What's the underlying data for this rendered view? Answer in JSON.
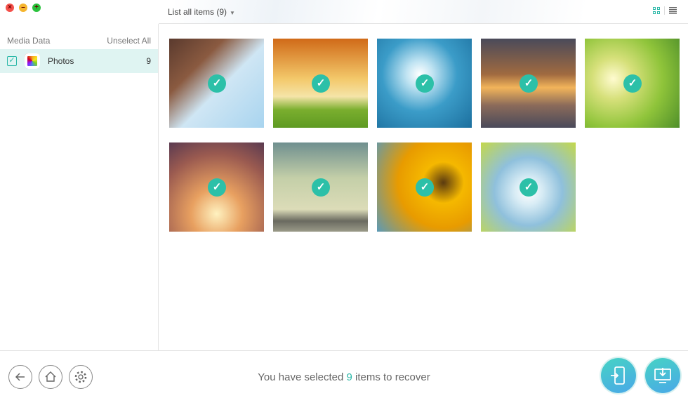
{
  "window": {
    "controls": [
      "close",
      "minimize",
      "maximize"
    ]
  },
  "sidebar": {
    "header": "Media Data",
    "unselect_all": "Unselect All",
    "items": [
      {
        "label": "Photos",
        "count": "9",
        "checked": true,
        "icon": "photos-app-icon"
      }
    ]
  },
  "main": {
    "filter_label": "List all items (9)",
    "view_modes": [
      "grid",
      "list"
    ],
    "active_view": "grid",
    "photos": [
      {
        "bg": "linear-gradient(135deg,#5a3a2e 0%,#8a5a40 30%,#cfe6f4 55%,#a8d4ef 100%)"
      },
      {
        "bg": "linear-gradient(180deg,#d06a18 0%,#f3c86a 45%,#f5e4a8 65%,#7aae2e 80%,#5e9a22 100%)"
      },
      {
        "bg": "radial-gradient(circle at 45% 40%,#ffffff 0%,#bfe3f2 18%,#3b9cc8 50%,#1c6f9e 100%)"
      },
      {
        "bg": "linear-gradient(180deg,#4a4a5a 0%,#a06a40 40%,#f2b45a 55%,#8a6a5a 75%,#4a4a5a 100%)"
      },
      {
        "bg": "radial-gradient(circle at 30% 45%,#fffbd0 0%,#d6e07a 25%,#8fc43a 60%,#4f8f2a 100%)"
      },
      {
        "bg": "radial-gradient(circle at 50% 80%,#fff2c0 0%,#e8a060 30%,#9a5a50 70%,#5a3a50 100%)"
      },
      {
        "bg": "linear-gradient(180deg,#6f8f8f 0%,#c4cfa8 40%,#dcdcb8 75%,#6a6a60 88%,#9a9a88 100%)"
      },
      {
        "bg": "radial-gradient(circle at 70% 45%,#5a3a10 0%,#f5b800 25%,#e89b00 55%,#5a9ab8 100%)"
      },
      {
        "bg": "radial-gradient(circle at 50% 55%,#ffffff 0%,#d8ecf5 20%,#8fc0dc 50%,#c4d84a 100%)"
      }
    ]
  },
  "footer": {
    "status_prefix": "You have selected ",
    "selected_count": "9",
    "status_suffix": " items to recover",
    "buttons": [
      "back",
      "home",
      "settings",
      "recover-to-device",
      "recover-to-computer"
    ]
  },
  "colors": {
    "accent": "#2bb8a8",
    "selected_row": "#dff4f2",
    "check_badge": "#2cc0a8"
  }
}
